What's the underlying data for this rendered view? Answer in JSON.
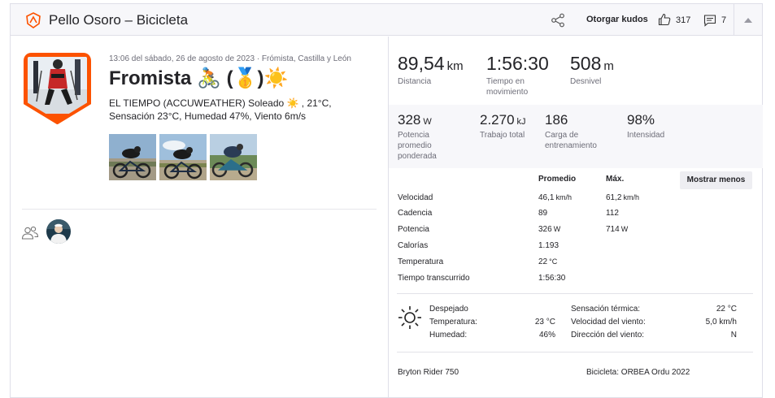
{
  "header": {
    "title": "Pello Osoro – Bicicleta",
    "kudos_label": "Otorgar kudos",
    "kudos_count": "317",
    "comment_count": "7"
  },
  "activity": {
    "date_line": "13:06 del sábado, 26 de agosto de 2023 · Frómista, Castilla y León",
    "title": "Fromista 🚴 (🥇)☀️",
    "description_line1": "EL TIEMPO (ACCUWEATHER) Soleado ☀️ , 21°C,",
    "description_line2": "Sensación 23°C, Humedad 47%, Viento 6m/s"
  },
  "primary_stats": [
    {
      "value": "89,54",
      "unit": "km",
      "label": "Distancia"
    },
    {
      "value": "1:56:30",
      "unit": "",
      "label": "Tiempo en movimiento"
    },
    {
      "value": "508",
      "unit": "m",
      "label": "Desnivel"
    }
  ],
  "secondary_stats": [
    {
      "value": "328",
      "unit": "W",
      "label": "Potencia promedio ponderada"
    },
    {
      "value": "2.270",
      "unit": "kJ",
      "label": "Trabajo total"
    },
    {
      "value": "186",
      "unit": "",
      "label": "Carga de entrenamiento"
    },
    {
      "value": "98%",
      "unit": "",
      "label": "Intensidad"
    }
  ],
  "details_table": {
    "col_avg": "Promedio",
    "col_max": "Máx.",
    "show_less_label": "Mostrar menos",
    "rows": [
      {
        "label": "Velocidad",
        "avg": "46,1",
        "avg_unit": "km/h",
        "max": "61,2",
        "max_unit": "km/h"
      },
      {
        "label": "Cadencia",
        "avg": "89",
        "avg_unit": "",
        "max": "112",
        "max_unit": ""
      },
      {
        "label": "Potencia",
        "avg": "326",
        "avg_unit": "W",
        "max": "714",
        "max_unit": "W"
      },
      {
        "label": "Calorías",
        "avg": "1.193",
        "avg_unit": "",
        "max": "",
        "max_unit": ""
      },
      {
        "label": "Temperatura",
        "avg": "22",
        "avg_unit": "°C",
        "max": "",
        "max_unit": ""
      },
      {
        "label": "Tiempo transcurrido",
        "avg": "1:56:30",
        "avg_unit": "",
        "max": "",
        "max_unit": ""
      }
    ]
  },
  "weather": {
    "condition": "Despejado",
    "temp_label": "Temperatura:",
    "temp_value": "23 °C",
    "humidity_label": "Humedad:",
    "humidity_value": "46%",
    "feels_label": "Sensación térmica:",
    "feels_value": "22 °C",
    "wind_speed_label": "Velocidad del viento:",
    "wind_speed_value": "5,0 km/h",
    "wind_dir_label": "Dirección del viento:",
    "wind_dir_value": "N"
  },
  "gear": {
    "device": "Bryton Rider 750",
    "bike": "Bicicleta: ORBEA Ordu 2022"
  },
  "colors": {
    "brand": "#fc5200",
    "text": "#242428",
    "muted": "#6d6d78",
    "band": "#f7f7fa"
  }
}
